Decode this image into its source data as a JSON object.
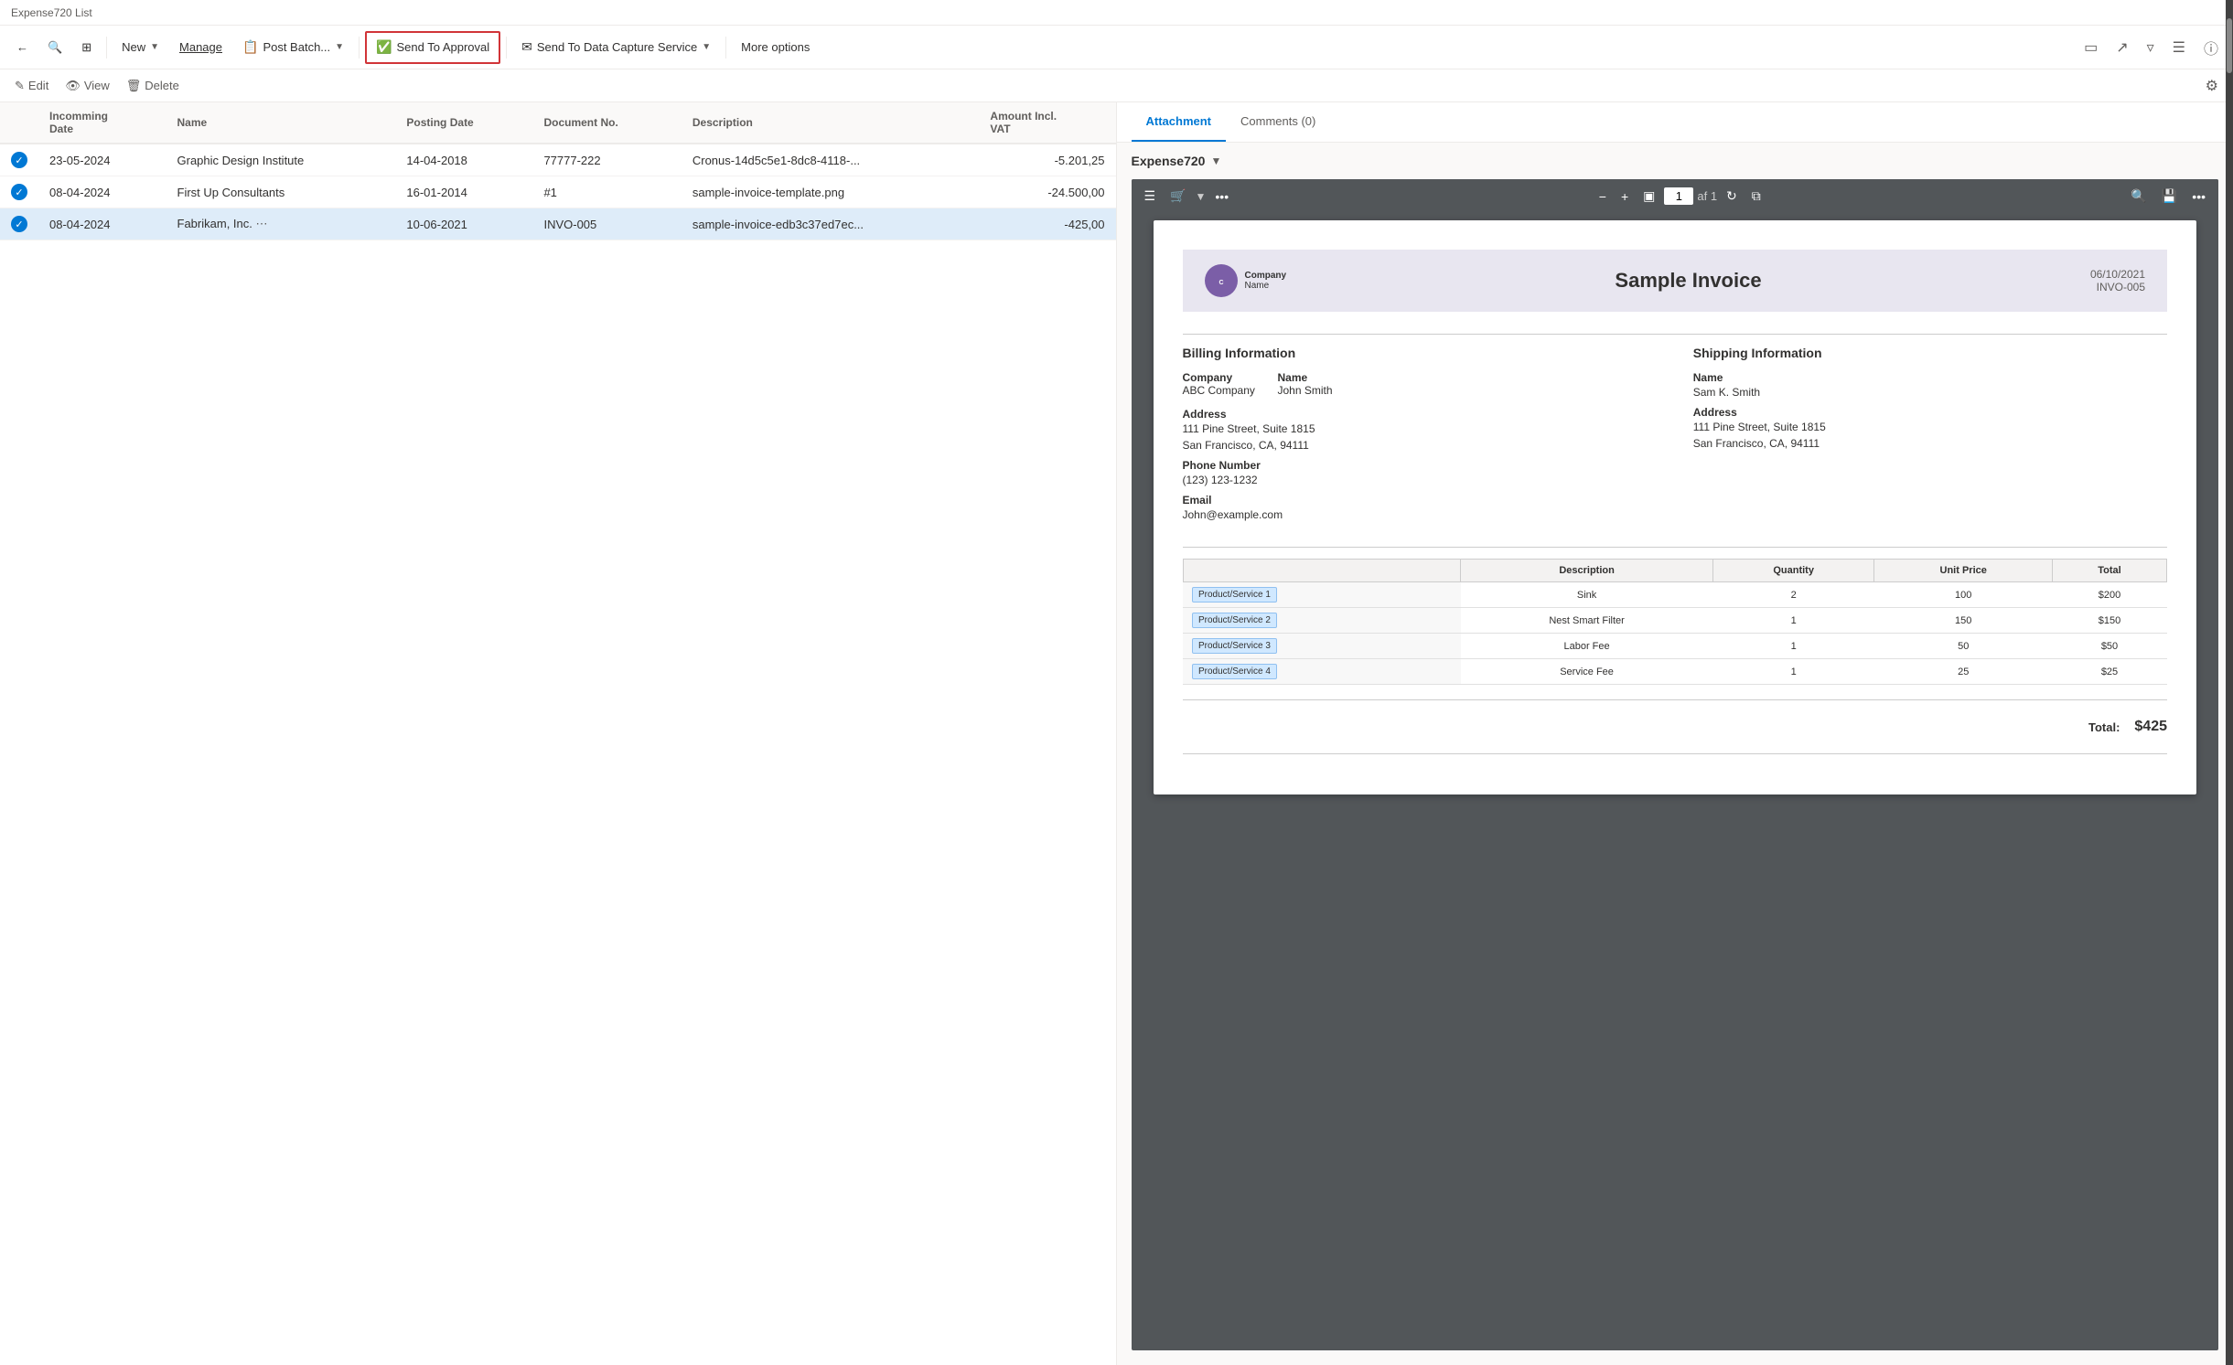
{
  "titleBar": {
    "text": "Expense720 List"
  },
  "commandBar": {
    "backLabel": "←",
    "searchLabel": "🔍",
    "viewLabel": "⊞",
    "newLabel": "New",
    "manageLabel": "Manage",
    "postBatchLabel": "Post Batch...",
    "sendApprovalLabel": "Send To Approval",
    "sendCaptureLabel": "Send To Data Capture Service",
    "moreOptionsLabel": "More options",
    "bookmarkLabel": "🔖",
    "shareLabel": "↗",
    "filterLabel": "▼",
    "columnsLabel": "☰",
    "infoLabel": "ℹ"
  },
  "actionBar": {
    "editLabel": "Edit",
    "viewLabel": "View",
    "deleteLabel": "Delete",
    "settingsLabel": "⚙"
  },
  "table": {
    "columns": [
      "",
      "Incomming Date",
      "Name",
      "Posting Date",
      "Document No.",
      "Description",
      "Amount Incl. VAT"
    ],
    "rows": [
      {
        "checked": true,
        "incommingDate": "23-05-2024",
        "name": "Graphic Design Institute",
        "postingDate": "14-04-2018",
        "documentNo": "77777-222",
        "description": "Cronus-14d5c5e1-8dc8-4118-...",
        "amount": "-5.201,25",
        "selected": false,
        "dots": false
      },
      {
        "checked": true,
        "incommingDate": "08-04-2024",
        "name": "First Up Consultants",
        "postingDate": "16-01-2014",
        "documentNo": "#1",
        "description": "sample-invoice-template.png",
        "amount": "-24.500,00",
        "selected": false,
        "dots": false
      },
      {
        "checked": true,
        "incommingDate": "08-04-2024",
        "name": "Fabrikam, Inc.",
        "postingDate": "10-06-2021",
        "documentNo": "INVO-005",
        "description": "sample-invoice-edb3c37ed7ec...",
        "amount": "-425,00",
        "selected": true,
        "dots": true
      }
    ]
  },
  "detailPanel": {
    "tabs": [
      {
        "label": "Attachment",
        "active": true
      },
      {
        "label": "Comments (0)",
        "active": false
      }
    ],
    "expenseTitle": "Expense720",
    "pdfToolbar": {
      "menuIcon": "☰",
      "cartIcon": "🛒",
      "moreIcon": "•••",
      "zoomOut": "−",
      "zoomIn": "+",
      "fitIcon": "⬜",
      "page": "1",
      "pageOf": "af 1",
      "refreshIcon": "↻",
      "copyIcon": "⧉",
      "searchIcon": "🔍",
      "saveIcon": "💾",
      "overflowIcon": "•••"
    },
    "invoice": {
      "date": "06/10/2021",
      "invoiceNumber": "INVO-005",
      "logoText": "Company Name",
      "title": "Sample Invoice",
      "divider": true,
      "billing": {
        "heading": "Billing Information",
        "companyLabel": "Company",
        "companyValue": "ABC Company",
        "nameLabel": "Name",
        "nameValue": "John Smith",
        "addressLabel": "Address",
        "addressLine1": "111 Pine Street, Suite 1815",
        "addressLine2": "San Francisco, CA, 94111",
        "phoneLabel": "Phone Number",
        "phoneValue": "(123) 123-1232",
        "emailLabel": "Email",
        "emailValue": "John@example.com"
      },
      "shipping": {
        "heading": "Shipping Information",
        "nameLabel": "Name",
        "nameValue": "Sam K. Smith",
        "addressLabel": "Address",
        "addressLine1": "111 Pine Street, Suite 1815",
        "addressLine2": "San Francisco, CA, 94111"
      },
      "itemsTable": {
        "columns": [
          "",
          "Description",
          "Quantity",
          "Unit Price",
          "Total"
        ],
        "rows": [
          {
            "product": "Product/Service 1",
            "description": "Sink",
            "quantity": "2",
            "unitPrice": "100",
            "total": "$200"
          },
          {
            "product": "Product/Service 2",
            "description": "Nest Smart Filter",
            "quantity": "1",
            "unitPrice": "150",
            "total": "$150"
          },
          {
            "product": "Product/Service 3",
            "description": "Labor Fee",
            "quantity": "1",
            "unitPrice": "50",
            "total": "$50"
          },
          {
            "product": "Product/Service 4",
            "description": "Service Fee",
            "quantity": "1",
            "unitPrice": "25",
            "total": "$25"
          }
        ]
      },
      "totalLabel": "Total:",
      "totalValue": "$425"
    }
  }
}
